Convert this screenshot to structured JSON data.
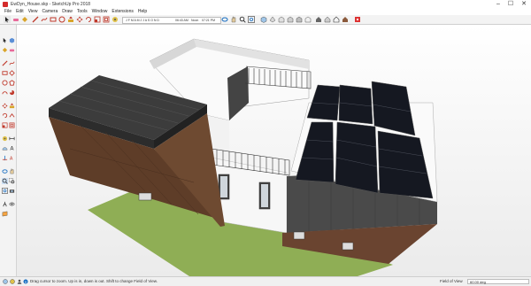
{
  "window": {
    "title": "EwDyn_House.skp - SketchUp Pro 2018",
    "minimize": "–",
    "maximize": "☐",
    "close": "✕"
  },
  "menu": [
    "File",
    "Edit",
    "View",
    "Camera",
    "Draw",
    "Tools",
    "Window",
    "Extensions",
    "Help"
  ],
  "shadow_settings": {
    "months": "J F M A M J J A S O N D",
    "time_start": "06:43 AM",
    "noon": "Noon",
    "time_end": "07:21 PM"
  },
  "status": {
    "hint": "Drag cursor to zoom. Up is in, down is out. Shift to change Field of View.",
    "fov_label": "Field of View",
    "fov_value": "60.00 deg"
  },
  "colors": {
    "accent": "#1a6fc2",
    "panel_dark": "#303030",
    "wood": "#5e3d28",
    "grass": "#8fae55",
    "solar": "#151821"
  }
}
